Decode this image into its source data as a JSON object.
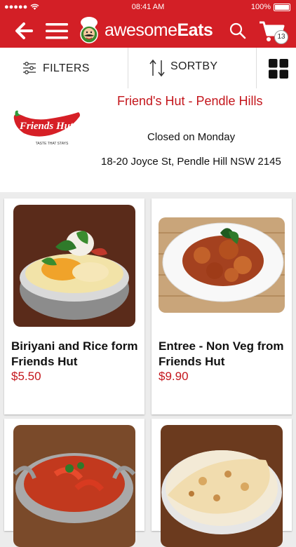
{
  "status_bar": {
    "time": "08:41 AM",
    "battery": "100%"
  },
  "app_bar": {
    "brand_light": "awesome",
    "brand_bold": "Eats",
    "cart_count": "13"
  },
  "toolbar": {
    "filters_label": "FILTERS",
    "sort_label": "SORTBY"
  },
  "restaurant": {
    "name": "Friend's Hut - Pendle Hills",
    "status": "Closed on Monday",
    "address": "18-20 Joyce St, Pendle Hill NSW 2145",
    "logo_text": "Friends Hut",
    "logo_tagline": "TASTE THAT STAYS"
  },
  "items": [
    {
      "title": "Biriyani and Rice form Friends Hut",
      "price": "$5.50"
    },
    {
      "title": "Entree - Non Veg from Friends Hut",
      "price": "$9.90"
    },
    {
      "title": "",
      "price": ""
    },
    {
      "title": "",
      "price": ""
    }
  ],
  "colors": {
    "brand_red": "#d31f26",
    "price_red": "#c4161c"
  }
}
